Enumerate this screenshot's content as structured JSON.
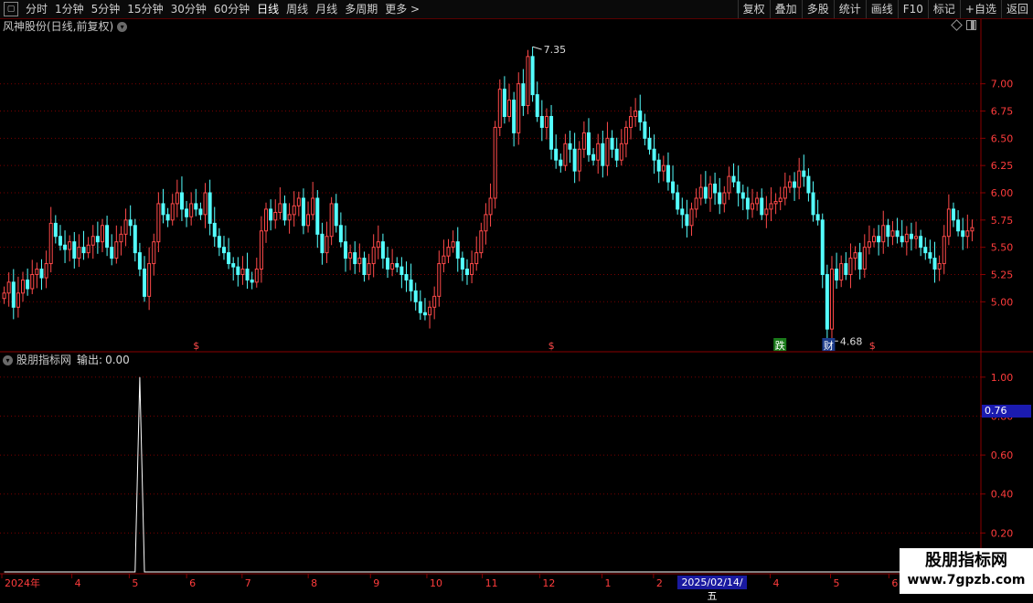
{
  "toolbar": {
    "icon": "window-icon",
    "periods": [
      "分时",
      "1分钟",
      "5分钟",
      "15分钟",
      "30分钟",
      "60分钟",
      "日线",
      "周线",
      "月线",
      "多周期",
      "更多 >"
    ],
    "active_period": "日线",
    "buttons": [
      "复权",
      "叠加",
      "多股",
      "统计",
      "画线",
      "F10",
      "标记",
      "+自选",
      "返回"
    ]
  },
  "main_chart": {
    "title": "风神股份(日线,前复权)",
    "y_ticks": [
      "7.00",
      "6.75",
      "6.50",
      "6.25",
      "6.00",
      "5.75",
      "5.50",
      "5.25",
      "5.00"
    ],
    "high_label": "7.35",
    "low_label": "4.68",
    "markers": [
      "$",
      "$",
      "跌",
      "财",
      "$"
    ]
  },
  "indicator": {
    "title": "股朋指标网",
    "output_label": "输出:",
    "output_value": "0.00",
    "y_ticks": [
      "1.00",
      "0.80",
      "0.60",
      "0.40",
      "0.20"
    ],
    "cursor_value": "0.76"
  },
  "x_axis": {
    "labels": [
      "2024年",
      "4",
      "5",
      "6",
      "7",
      "8",
      "9",
      "10",
      "11",
      "12",
      "1",
      "2",
      "4",
      "5",
      "6"
    ],
    "highlight": "2025/02/14/五"
  },
  "watermark": {
    "line1": "股朋指标网",
    "line2": "www.7gpzb.com"
  },
  "colors": {
    "up": "#ff4a4a",
    "down": "#54ffff",
    "grid": "#7a0000",
    "axis_text": "#ff3c3c"
  },
  "chart_data": {
    "type": "candlestick",
    "price_ylim": [
      4.55,
      7.45
    ],
    "indicator_ylim": [
      0.0,
      1.06
    ],
    "close_series": [
      5.08,
      5.18,
      4.95,
      5.08,
      5.2,
      5.12,
      5.25,
      5.3,
      5.22,
      5.35,
      5.72,
      5.6,
      5.52,
      5.48,
      5.55,
      5.4,
      5.5,
      5.45,
      5.52,
      5.6,
      5.55,
      5.7,
      5.5,
      5.4,
      5.55,
      5.62,
      5.75,
      5.7,
      5.45,
      5.3,
      5.05,
      5.35,
      5.55,
      5.9,
      5.8,
      5.75,
      5.9,
      6.0,
      5.85,
      5.78,
      5.9,
      5.85,
      5.8,
      6.0,
      5.72,
      5.6,
      5.5,
      5.45,
      5.35,
      5.32,
      5.25,
      5.3,
      5.2,
      5.18,
      5.3,
      5.65,
      5.85,
      5.75,
      5.82,
      5.9,
      5.75,
      5.8,
      5.88,
      5.95,
      5.7,
      5.8,
      5.95,
      5.62,
      5.45,
      5.6,
      5.9,
      5.7,
      5.55,
      5.4,
      5.45,
      5.35,
      5.4,
      5.25,
      5.35,
      5.5,
      5.55,
      5.4,
      5.3,
      5.35,
      5.32,
      5.25,
      5.2,
      5.1,
      5.0,
      4.9,
      4.88,
      4.95,
      5.05,
      5.35,
      5.42,
      5.5,
      5.55,
      5.4,
      5.3,
      5.25,
      5.35,
      5.45,
      5.65,
      5.8,
      5.95,
      6.6,
      6.95,
      6.7,
      6.85,
      6.55,
      7.0,
      6.8,
      7.25,
      6.9,
      6.7,
      6.6,
      6.7,
      6.4,
      6.3,
      6.25,
      6.45,
      6.4,
      6.2,
      6.4,
      6.55,
      6.35,
      6.3,
      6.45,
      6.25,
      6.5,
      6.4,
      6.3,
      6.45,
      6.6,
      6.7,
      6.75,
      6.65,
      6.5,
      6.4,
      6.3,
      6.2,
      6.25,
      6.1,
      6.0,
      5.85,
      5.8,
      5.7,
      5.85,
      5.95,
      6.05,
      5.95,
      6.08,
      6.0,
      5.9,
      6.0,
      6.15,
      6.1,
      6.0,
      5.95,
      5.85,
      5.9,
      5.95,
      5.8,
      5.85,
      5.9,
      5.92,
      5.95,
      6.05,
      6.1,
      6.05,
      6.2,
      6.15,
      6.0,
      5.8,
      5.75,
      5.25,
      4.75,
      5.3,
      5.2,
      5.35,
      5.25,
      5.4,
      5.45,
      5.3,
      5.5,
      5.55,
      5.6,
      5.55,
      5.7,
      5.6,
      5.65,
      5.6,
      5.55,
      5.62,
      5.58,
      5.6,
      5.5,
      5.45,
      5.4,
      5.3,
      5.35,
      5.6,
      5.85,
      5.75,
      5.65,
      5.6,
      5.65,
      5.68
    ],
    "indicator_series": [
      0,
      0,
      0,
      0,
      0,
      0,
      0,
      0,
      0,
      0,
      0,
      0,
      0,
      0,
      0,
      0,
      0,
      0,
      0,
      0,
      0,
      0,
      0,
      0,
      0,
      0,
      0,
      0,
      0,
      0,
      0,
      0,
      0,
      0,
      0,
      0,
      0,
      0,
      0,
      0,
      0,
      0,
      0,
      0,
      0,
      0,
      0,
      0,
      0,
      0,
      0,
      0,
      0,
      0,
      0,
      0,
      0,
      0,
      0,
      0,
      0,
      0,
      0,
      0,
      0,
      0,
      0,
      0,
      0,
      0,
      0,
      0,
      0,
      0,
      0,
      0,
      0,
      0,
      0,
      0,
      0,
      0,
      0,
      0,
      0,
      0,
      0,
      0,
      0,
      0,
      0,
      0,
      0,
      0,
      0,
      0,
      0,
      0,
      0,
      0,
      0,
      0,
      0,
      0,
      0,
      0,
      0,
      0,
      0,
      0,
      0,
      0,
      0,
      0,
      0,
      0,
      0,
      0,
      0,
      0,
      0,
      0,
      0,
      0,
      0,
      0,
      0,
      0,
      0,
      0,
      0,
      0,
      0,
      0,
      0,
      0,
      0,
      0,
      0,
      0,
      0,
      0,
      0,
      0,
      0,
      0,
      0,
      0,
      0,
      0,
      0,
      0,
      0,
      0,
      0,
      0,
      0,
      0,
      0,
      0,
      0,
      0,
      0,
      0,
      0,
      0,
      0,
      0,
      0,
      0,
      0,
      0,
      0,
      0,
      0,
      0,
      0,
      0,
      0,
      0,
      0,
      0,
      0,
      0,
      0,
      0,
      0,
      0,
      0,
      0,
      0,
      0,
      0,
      0,
      0,
      0,
      0,
      0,
      0,
      0,
      0,
      0,
      0,
      0,
      0,
      0,
      0,
      0,
      0,
      0
    ],
    "indicator_spike": {
      "date_label": "5",
      "value": 1.0
    }
  }
}
